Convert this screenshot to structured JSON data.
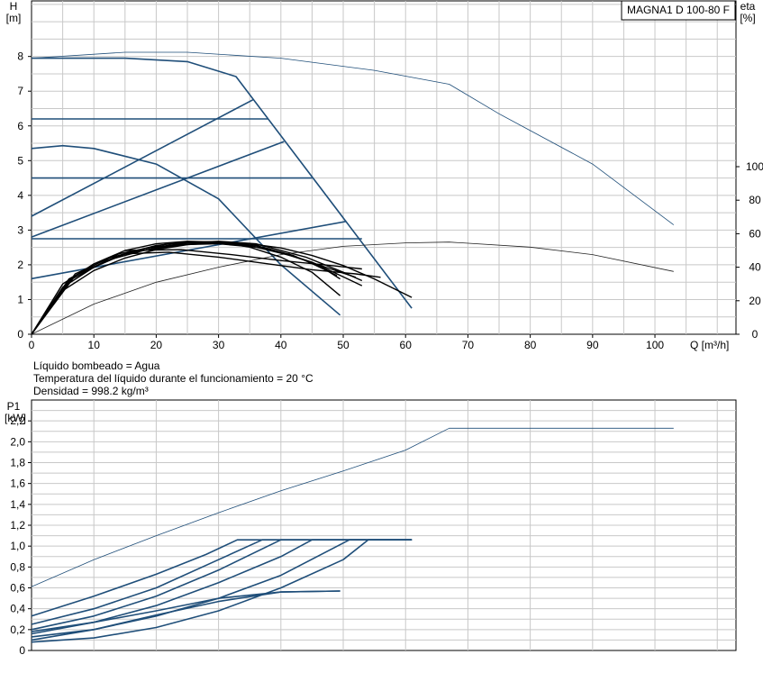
{
  "pump_label": "MAGNA1 D 100-80 F",
  "fluid_info": {
    "liquid": "Líquido bombeado = Agua",
    "temperature": "Temperatura del líquido durante el funcionamiento = 20 °C",
    "density": "Densidad = 998.2 kg/m³"
  },
  "colors": {
    "curve_blue": "#1f4e79",
    "curve_black": "#000000",
    "grid": "#c8c8c8"
  },
  "chart_data": [
    {
      "type": "line",
      "id": "head-efficiency",
      "ylabel_left": [
        "H",
        "[m]"
      ],
      "ylabel_right": [
        "eta",
        "[%]"
      ],
      "xlabel": "Q [m³/h]",
      "xlim": [
        0,
        113
      ],
      "ylim": [
        0,
        9.6
      ],
      "x_ticks": [
        0,
        10,
        20,
        30,
        40,
        50,
        60,
        70,
        80,
        90,
        100
      ],
      "y_ticks": [
        0,
        1,
        2,
        3,
        4,
        5,
        6,
        7,
        8
      ],
      "y_right_ticks": [
        0,
        20,
        40,
        60,
        80,
        100
      ],
      "y_right_lim": [
        0,
        100
      ],
      "grid": true,
      "series": [
        {
          "kind": "head",
          "style": "max-thin",
          "points": [
            [
              0,
              7.95
            ],
            [
              15,
              8.12
            ],
            [
              25,
              8.12
            ],
            [
              40,
              7.95
            ],
            [
              55,
              7.6
            ],
            [
              67,
              7.2
            ],
            [
              75,
              6.35
            ],
            [
              90,
              4.9
            ],
            [
              103,
              3.15
            ]
          ]
        },
        {
          "kind": "head",
          "style": "max",
          "points": [
            [
              0,
              7.95
            ],
            [
              15,
              7.95
            ],
            [
              25,
              7.85
            ],
            [
              32.8,
              7.42
            ],
            [
              61,
              0.75
            ]
          ]
        },
        {
          "kind": "head",
          "style": "min",
          "points": [
            [
              0,
              5.35
            ],
            [
              5,
              5.43
            ],
            [
              10,
              5.35
            ],
            [
              20,
              4.9
            ],
            [
              30,
              3.9
            ],
            [
              40,
              2.0
            ],
            [
              49.5,
              0.55
            ]
          ]
        },
        {
          "kind": "head",
          "style": "ctrl",
          "points": [
            [
              0,
              6.2
            ],
            [
              38,
              6.2
            ]
          ]
        },
        {
          "kind": "head",
          "style": "ctrl",
          "points": [
            [
              0,
              4.5
            ],
            [
              45,
              4.5
            ]
          ]
        },
        {
          "kind": "head",
          "style": "ctrl",
          "points": [
            [
              0,
              2.75
            ],
            [
              53,
              2.75
            ]
          ]
        },
        {
          "kind": "head",
          "style": "ctrl",
          "points": [
            [
              0,
              3.4
            ],
            [
              35.5,
              6.75
            ]
          ]
        },
        {
          "kind": "head",
          "style": "ctrl",
          "points": [
            [
              0,
              2.8
            ],
            [
              40.5,
              5.55
            ]
          ]
        },
        {
          "kind": "head",
          "style": "ctrl",
          "points": [
            [
              0,
              1.6
            ],
            [
              50.5,
              3.25
            ]
          ]
        },
        {
          "kind": "eta",
          "style": "max-thin",
          "points": [
            [
              0,
              0
            ],
            [
              10,
              18
            ],
            [
              20,
              31
            ],
            [
              30,
              40
            ],
            [
              40,
              47.5
            ],
            [
              50,
              52.5
            ],
            [
              60,
              54.5
            ],
            [
              67,
              55
            ],
            [
              80,
              52
            ],
            [
              90,
              47.5
            ],
            [
              103,
              37.5
            ]
          ]
        },
        {
          "kind": "eta",
          "style": "main",
          "points": [
            [
              0,
              0
            ],
            [
              5,
              26
            ],
            [
              10,
              38
            ],
            [
              15,
              45.5
            ],
            [
              20,
              50.5
            ],
            [
              25,
              53.5
            ],
            [
              30,
              54.7
            ],
            [
              35,
              54
            ],
            [
              40,
              51.5
            ],
            [
              45,
              47
            ],
            [
              50,
              41
            ],
            [
              55,
              33
            ],
            [
              61,
              22
            ]
          ]
        },
        {
          "kind": "eta",
          "style": "main",
          "points": [
            [
              0,
              0
            ],
            [
              5,
              28
            ],
            [
              10,
              40
            ],
            [
              15,
              48
            ],
            [
              20,
              53
            ],
            [
              25,
              55
            ],
            [
              30,
              55.2
            ],
            [
              35,
              53
            ],
            [
              40,
              49
            ],
            [
              45,
              43
            ],
            [
              49,
              36
            ],
            [
              53,
              29
            ]
          ]
        },
        {
          "kind": "eta",
          "style": "main",
          "points": [
            [
              0,
              0
            ],
            [
              5,
              30
            ],
            [
              10,
              42
            ],
            [
              15,
              50
            ],
            [
              20,
              54
            ],
            [
              25,
              55.5
            ],
            [
              30,
              55
            ],
            [
              35,
              52
            ],
            [
              40,
              46
            ],
            [
              45,
              37
            ],
            [
              49.5,
              23
            ]
          ]
        },
        {
          "kind": "eta",
          "style": "main",
          "points": [
            [
              0,
              0
            ],
            [
              6,
              32
            ],
            [
              12,
              44
            ],
            [
              18,
              50
            ],
            [
              24,
              53.5
            ],
            [
              30,
              54
            ],
            [
              36,
              52
            ],
            [
              42,
              46.5
            ],
            [
              48,
              39
            ],
            [
              52,
              34
            ]
          ]
        },
        {
          "kind": "eta",
          "style": "main",
          "points": [
            [
              0,
              0
            ],
            [
              6,
              33
            ],
            [
              12,
              45
            ],
            [
              18,
              51
            ],
            [
              25,
              54.5
            ],
            [
              32,
              54
            ],
            [
              38,
              51
            ],
            [
              44,
              44
            ],
            [
              49,
              35
            ]
          ]
        },
        {
          "kind": "eta",
          "style": "main",
          "points": [
            [
              0,
              0
            ],
            [
              7,
              35
            ],
            [
              14,
              47
            ],
            [
              22,
              53
            ],
            [
              30,
              55
            ],
            [
              36,
              53
            ],
            [
              42,
              47
            ],
            [
              47,
              39
            ],
            [
              49.5,
              33
            ]
          ]
        },
        {
          "kind": "eta",
          "style": "main",
          "points": [
            [
              0,
              0
            ],
            [
              7,
              36
            ],
            [
              14,
              48
            ],
            [
              22,
              54
            ],
            [
              30,
              55.5
            ],
            [
              36,
              54
            ],
            [
              44,
              46
            ],
            [
              50,
              37
            ],
            [
              53,
              32
            ]
          ]
        },
        {
          "kind": "eta",
          "style": "main",
          "points": [
            [
              15,
              48
            ],
            [
              22,
              49
            ],
            [
              30,
              46
            ],
            [
              38,
              42
            ],
            [
              45,
              38.5
            ],
            [
              52,
              36
            ],
            [
              56,
              34
            ]
          ]
        },
        {
          "kind": "eta",
          "style": "main",
          "points": [
            [
              15,
              50
            ],
            [
              24,
              50.5
            ],
            [
              32,
              47.5
            ],
            [
              40,
              44
            ],
            [
              48,
              41
            ],
            [
              53,
              39
            ]
          ]
        }
      ]
    },
    {
      "type": "line",
      "id": "power",
      "ylabel_left": [
        "P1",
        "[kW]"
      ],
      "xlim": [
        0,
        113
      ],
      "ylim": [
        0,
        2.4
      ],
      "y_ticks": [
        "0",
        "0,2",
        "0,4",
        "0,6",
        "0,8",
        "1,0",
        "1,2",
        "1,4",
        "1,6",
        "1,8",
        "2,0",
        "2,2"
      ],
      "y_tick_values": [
        0,
        0.2,
        0.4,
        0.6,
        0.8,
        1.0,
        1.2,
        1.4,
        1.6,
        1.8,
        2.0,
        2.2
      ],
      "grid": true,
      "series": [
        {
          "style": "max-thin",
          "points": [
            [
              0,
              0.61
            ],
            [
              10,
              0.87
            ],
            [
              20,
              1.1
            ],
            [
              30,
              1.32
            ],
            [
              40,
              1.53
            ],
            [
              50,
              1.72
            ],
            [
              60,
              1.92
            ],
            [
              67,
              2.13
            ],
            [
              103,
              2.13
            ]
          ]
        },
        {
          "style": "main",
          "points": [
            [
              0,
              0.33
            ],
            [
              10,
              0.52
            ],
            [
              20,
              0.73
            ],
            [
              28,
              0.92
            ],
            [
              33,
              1.06
            ],
            [
              61,
              1.06
            ]
          ]
        },
        {
          "style": "main",
          "points": [
            [
              0,
              0.25
            ],
            [
              10,
              0.4
            ],
            [
              20,
              0.6
            ],
            [
              30,
              0.87
            ],
            [
              37,
              1.06
            ],
            [
              61,
              1.06
            ]
          ]
        },
        {
          "style": "main",
          "points": [
            [
              0,
              0.2
            ],
            [
              10,
              0.33
            ],
            [
              20,
              0.52
            ],
            [
              30,
              0.77
            ],
            [
              40,
              1.06
            ],
            [
              61,
              1.06
            ]
          ]
        },
        {
          "style": "main",
          "points": [
            [
              0,
              0.16
            ],
            [
              10,
              0.27
            ],
            [
              20,
              0.43
            ],
            [
              30,
              0.65
            ],
            [
              40,
              0.9
            ],
            [
              45,
              1.06
            ],
            [
              61,
              1.06
            ]
          ]
        },
        {
          "style": "main",
          "points": [
            [
              0,
              0.13
            ],
            [
              10,
              0.2
            ],
            [
              20,
              0.33
            ],
            [
              30,
              0.5
            ],
            [
              40,
              0.72
            ],
            [
              51,
              1.06
            ],
            [
              61,
              1.06
            ]
          ]
        },
        {
          "style": "main",
          "points": [
            [
              0,
              0.08
            ],
            [
              10,
              0.12
            ],
            [
              20,
              0.22
            ],
            [
              30,
              0.38
            ],
            [
              40,
              0.6
            ],
            [
              50,
              0.87
            ],
            [
              54,
              1.06
            ],
            [
              61,
              1.06
            ]
          ]
        },
        {
          "style": "main",
          "points": [
            [
              0,
              0.18
            ],
            [
              10,
              0.27
            ],
            [
              20,
              0.38
            ],
            [
              30,
              0.5
            ],
            [
              40,
              0.56
            ],
            [
              49.5,
              0.57
            ]
          ]
        },
        {
          "style": "main",
          "points": [
            [
              0,
              0.1
            ],
            [
              10,
              0.2
            ],
            [
              20,
              0.34
            ],
            [
              30,
              0.47
            ],
            [
              40,
              0.56
            ],
            [
              49.5,
              0.57
            ]
          ]
        }
      ]
    }
  ]
}
